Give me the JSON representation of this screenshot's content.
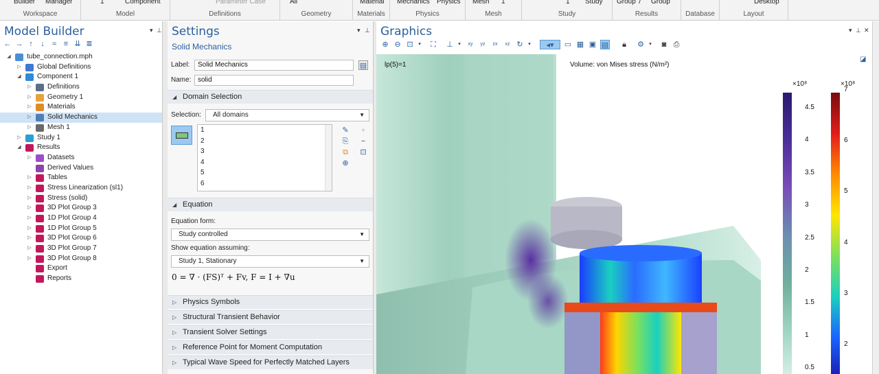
{
  "ribbon": {
    "groups": [
      {
        "label": "Workspace",
        "items": [
          "Builder",
          "Manager"
        ]
      },
      {
        "label": "Model",
        "items": [
          "1",
          "Component"
        ]
      },
      {
        "label": "Definitions",
        "items": [
          "Parameter Case"
        ]
      },
      {
        "label": "Geometry",
        "items": [
          "All"
        ]
      },
      {
        "label": "Materials",
        "items": [
          "Material"
        ]
      },
      {
        "label": "Physics",
        "items": [
          "Mechanics",
          "Physics"
        ]
      },
      {
        "label": "Mesh",
        "items": [
          "Mesh",
          "1"
        ]
      },
      {
        "label": "Study",
        "items": [
          "1",
          "Study"
        ]
      },
      {
        "label": "Results",
        "items": [
          "Group 7",
          "Group"
        ]
      },
      {
        "label": "Database",
        "items": []
      },
      {
        "label": "Layout",
        "items": [
          "Desktop"
        ]
      }
    ]
  },
  "model_builder": {
    "title": "Model Builder",
    "tree": [
      {
        "label": "tube_connection.mph",
        "level": 0,
        "toggle": "◢",
        "icon": "file-icon",
        "color": "#4a8fd6"
      },
      {
        "label": "Global Definitions",
        "level": 1,
        "toggle": "▷",
        "icon": "globe-icon",
        "color": "#3a7bd5"
      },
      {
        "label": "Component 1",
        "level": 1,
        "toggle": "◢",
        "icon": "component-icon",
        "color": "#2e8bd8"
      },
      {
        "label": "Definitions",
        "level": 2,
        "toggle": "▷",
        "icon": "definitions-icon",
        "color": "#5a6f8a"
      },
      {
        "label": "Geometry 1",
        "level": 2,
        "toggle": "▷",
        "icon": "geometry-icon",
        "color": "#e6a23c"
      },
      {
        "label": "Materials",
        "level": 2,
        "toggle": "▷",
        "icon": "materials-icon",
        "color": "#e08b2a"
      },
      {
        "label": "Solid Mechanics",
        "level": 2,
        "toggle": "▷",
        "icon": "solid-mechanics-icon",
        "color": "#4f7fb8",
        "selected": true
      },
      {
        "label": "Mesh 1",
        "level": 2,
        "toggle": "▷",
        "icon": "mesh-icon",
        "color": "#6a6a6a"
      },
      {
        "label": "Study 1",
        "level": 1,
        "toggle": "▷",
        "icon": "study-icon",
        "color": "#2a9fd6"
      },
      {
        "label": "Results",
        "level": 1,
        "toggle": "◢",
        "icon": "results-icon",
        "color": "#c2185b"
      },
      {
        "label": "Datasets",
        "level": 2,
        "toggle": "▷",
        "icon": "datasets-icon",
        "color": "#9c4dcc"
      },
      {
        "label": "Derived Values",
        "level": 2,
        "toggle": "",
        "icon": "derived-values-icon",
        "color": "#8e44ad"
      },
      {
        "label": "Tables",
        "level": 2,
        "toggle": "▷",
        "icon": "tables-icon",
        "color": "#c2185b"
      },
      {
        "label": "Stress Linearization (sl1)",
        "level": 2,
        "toggle": "▷",
        "icon": "line-plot-icon",
        "color": "#c2185b"
      },
      {
        "label": "Stress (solid)",
        "level": 2,
        "toggle": "▷",
        "icon": "plot-3d-icon",
        "color": "#c2185b"
      },
      {
        "label": "3D Plot Group 3",
        "level": 2,
        "toggle": "▷",
        "icon": "plot-3d-icon",
        "color": "#c2185b"
      },
      {
        "label": "1D Plot Group 4",
        "level": 2,
        "toggle": "▷",
        "icon": "line-plot-icon",
        "color": "#c2185b"
      },
      {
        "label": "1D Plot Group 5",
        "level": 2,
        "toggle": "▷",
        "icon": "line-plot-icon",
        "color": "#c2185b"
      },
      {
        "label": "3D Plot Group 6",
        "level": 2,
        "toggle": "▷",
        "icon": "plot-3d-icon",
        "color": "#c2185b"
      },
      {
        "label": "3D Plot Group 7",
        "level": 2,
        "toggle": "▷",
        "icon": "plot-3d-icon",
        "color": "#c2185b"
      },
      {
        "label": "3D Plot Group 8",
        "level": 2,
        "toggle": "▷",
        "icon": "plot-3d-icon",
        "color": "#c2185b"
      },
      {
        "label": "Export",
        "level": 2,
        "toggle": "",
        "icon": "export-icon",
        "color": "#c2185b"
      },
      {
        "label": "Reports",
        "level": 2,
        "toggle": "",
        "icon": "reports-icon",
        "color": "#c2185b"
      }
    ]
  },
  "settings": {
    "title": "Settings",
    "subtitle": "Solid Mechanics",
    "label_caption": "Label:",
    "label_value": "Solid Mechanics",
    "name_caption": "Name:",
    "name_value": "solid",
    "domain_section": "Domain Selection",
    "selection_caption": "Selection:",
    "selection_value": "All domains",
    "domains": [
      "1",
      "2",
      "3",
      "4",
      "5",
      "6"
    ],
    "equation_section": "Equation",
    "equation_form_caption": "Equation form:",
    "equation_form_value": "Study controlled",
    "show_equation_caption": "Show equation assuming:",
    "show_equation_value": "Study 1, Stationary",
    "equation_text": "0 = ∇ · (FS)ᵀ + Fv,   F = I + ∇u",
    "collapsed_sections": [
      "Physics Symbols",
      "Structural Transient Behavior",
      "Transient Solver Settings",
      "Reference Point for Moment Computation",
      "Typical Wave Speed for Perfectly Matched Layers"
    ]
  },
  "graphics": {
    "title": "Graphics",
    "parameter_label": "lp(5)=1",
    "plot_title": "Volume: von Mises stress (N/m²)",
    "colorbar_left": {
      "exponent": "×10⁸",
      "ticks": [
        "4.5",
        "4",
        "3.5",
        "3",
        "2.5",
        "2",
        "1.5",
        "1",
        "0.5"
      ],
      "colors": [
        "#2a1a6e",
        "#4b2e9a",
        "#7a4cb8",
        "#6b8fb0",
        "#6fae9c",
        "#9fd4c2",
        "#d8f0e8"
      ]
    },
    "colorbar_right": {
      "exponent": "×10⁸",
      "ticks": [
        "7",
        "6",
        "5",
        "4",
        "3",
        "2"
      ],
      "colors": [
        "#7a0c0c",
        "#e21b1b",
        "#ff8a00",
        "#ffe600",
        "#7fe05a",
        "#1ad0c0",
        "#1a64ff",
        "#1a1ab0"
      ]
    }
  }
}
